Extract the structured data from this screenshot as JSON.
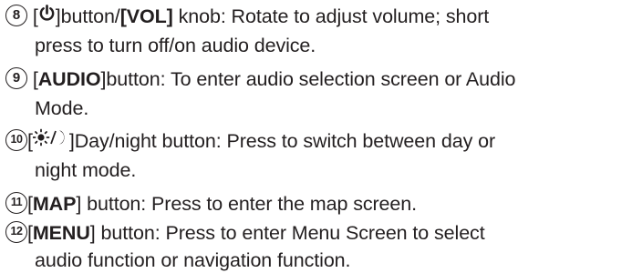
{
  "items": [
    {
      "number": "8",
      "icon": "power-icon",
      "middle": "button/",
      "key": "VOL",
      "desc1": " knob: Rotate to adjust volume; short",
      "desc2": "press to turn off/on audio device."
    },
    {
      "number": "9",
      "key": "AUDIO",
      "desc1": "button: To enter audio selection screen or Audio",
      "desc2": "Mode."
    },
    {
      "number": "10",
      "icon": "day-night-icon",
      "desc1": "Day/night button: Press to switch between day or",
      "desc2": "night mode."
    },
    {
      "number": "11",
      "key": "MAP",
      "desc1": " button: Press to enter the map screen."
    },
    {
      "number": "12",
      "key": "MENU",
      "desc1": " button: Press to enter Menu Screen to select",
      "desc2": "audio function or navigation function."
    }
  ]
}
